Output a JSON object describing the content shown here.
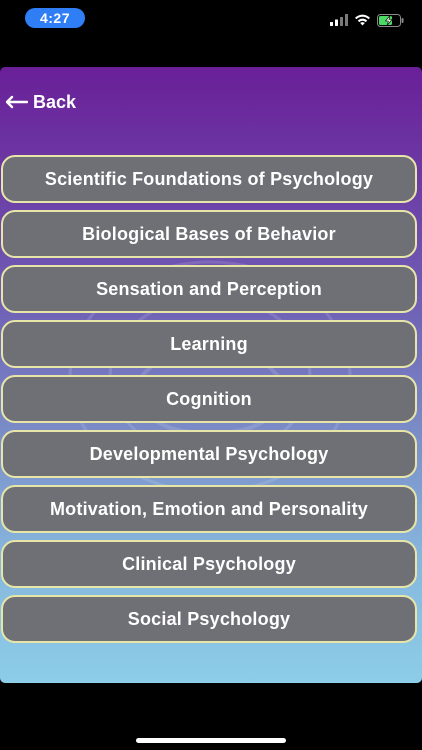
{
  "status_bar": {
    "time": "4:27",
    "icons": [
      "signal-icon",
      "wifi-icon",
      "battery-charging-icon"
    ],
    "accent_color": "#2f7ef6"
  },
  "nav": {
    "back_label": "Back",
    "back_icon": "arrow-left-icon"
  },
  "topics": [
    {
      "label": "Scientific Foundations of Psychology"
    },
    {
      "label": "Biological Bases of Behavior"
    },
    {
      "label": "Sensation and Perception"
    },
    {
      "label": "Learning"
    },
    {
      "label": "Cognition"
    },
    {
      "label": "Developmental Psychology"
    },
    {
      "label": "Motivation, Emotion and Personality"
    },
    {
      "label": "Clinical Psychology"
    },
    {
      "label": "Social Psychology"
    }
  ],
  "colors": {
    "button_fill": "#6f7075",
    "button_border": "#e7e6a8",
    "gradient_top": "#6a1f98",
    "gradient_bottom": "#8ccde8"
  }
}
